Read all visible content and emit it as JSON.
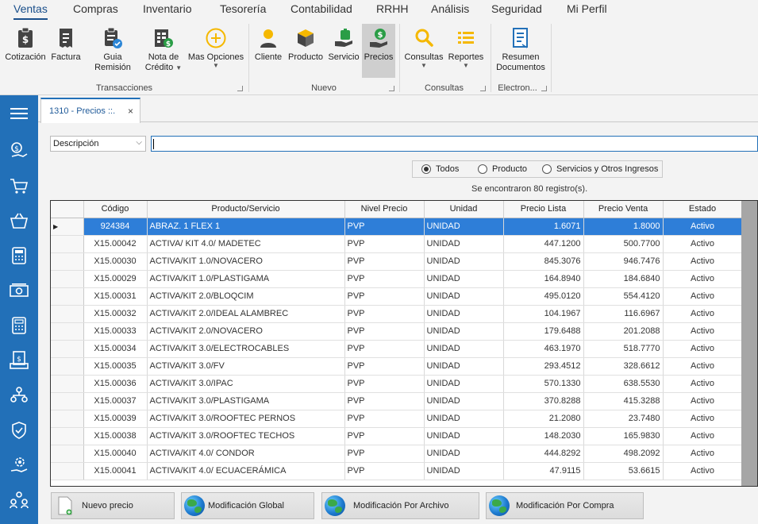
{
  "menu": [
    "Ventas",
    "Compras",
    "Inventario",
    "Tesorería",
    "Contabilidad",
    "RRHH",
    "Análisis",
    "Seguridad",
    "Mi Perfil"
  ],
  "ribbon": {
    "groups": [
      "Transacciones",
      "Nuevo",
      "Consultas",
      "Electron..."
    ],
    "buttons": {
      "cotizacion": "Cotización",
      "factura": "Factura",
      "guia": "Guia Remisión",
      "nota1": "Nota de",
      "nota2": "Crédito",
      "mas": "Mas Opciones",
      "cliente": "Cliente",
      "producto": "Producto",
      "servicio": "Servicio",
      "precios": "Precios",
      "consultas": "Consultas",
      "reportes": "Reportes",
      "resumen1": "Resumen",
      "resumen2": "Documentos"
    }
  },
  "tab": {
    "label": "1310 - Precios ::.",
    "close": "×"
  },
  "filter": {
    "field": "Descripción",
    "query": ""
  },
  "radios": {
    "todos": "Todos",
    "producto": "Producto",
    "servicios": "Servicios y Otros Ingresos"
  },
  "found_text": "Se encontraron 80 registro(s).",
  "grid": {
    "headers": [
      "Código",
      "Producto/Servicio",
      "Nivel Precio",
      "Unidad",
      "Precio Lista",
      "Precio Venta",
      "Estado"
    ],
    "rows": [
      [
        "924384",
        "ABRAZ. 1 FLEX  1",
        "PVP",
        "UNIDAD",
        "1.6071",
        "1.8000",
        "Activo"
      ],
      [
        "X15.00042",
        "ACTIVA/ KIT 4.0/ MADETEC",
        "PVP",
        "UNIDAD",
        "447.1200",
        "500.7700",
        "Activo"
      ],
      [
        "X15.00030",
        "ACTIVA/KIT 1.0/NOVACERO",
        "PVP",
        "UNIDAD",
        "845.3076",
        "946.7476",
        "Activo"
      ],
      [
        "X15.00029",
        "ACTIVA/KIT 1.0/PLASTIGAMA",
        "PVP",
        "UNIDAD",
        "164.8940",
        "184.6840",
        "Activo"
      ],
      [
        "X15.00031",
        "ACTIVA/KIT 2.0/BLOQCIM",
        "PVP",
        "UNIDAD",
        "495.0120",
        "554.4120",
        "Activo"
      ],
      [
        "X15.00032",
        "ACTIVA/KIT 2.0/IDEAL ALAMBREC",
        "PVP",
        "UNIDAD",
        "104.1967",
        "116.6967",
        "Activo"
      ],
      [
        "X15.00033",
        "ACTIVA/KIT 2.0/NOVACERO",
        "PVP",
        "UNIDAD",
        "179.6488",
        "201.2088",
        "Activo"
      ],
      [
        "X15.00034",
        "ACTIVA/KIT 3.0/ELECTROCABLES",
        "PVP",
        "UNIDAD",
        "463.1970",
        "518.7770",
        "Activo"
      ],
      [
        "X15.00035",
        "ACTIVA/KIT 3.0/FV",
        "PVP",
        "UNIDAD",
        "293.4512",
        "328.6612",
        "Activo"
      ],
      [
        "X15.00036",
        "ACTIVA/KIT 3.0/IPAC",
        "PVP",
        "UNIDAD",
        "570.1330",
        "638.5530",
        "Activo"
      ],
      [
        "X15.00037",
        "ACTIVA/KIT 3.0/PLASTIGAMA",
        "PVP",
        "UNIDAD",
        "370.8288",
        "415.3288",
        "Activo"
      ],
      [
        "X15.00039",
        "ACTIVA/KIT 3.0/ROOFTEC PERNOS",
        "PVP",
        "UNIDAD",
        "21.2080",
        "23.7480",
        "Activo"
      ],
      [
        "X15.00038",
        "ACTIVA/KIT 3.0/ROOFTEC TECHOS",
        "PVP",
        "UNIDAD",
        "148.2030",
        "165.9830",
        "Activo"
      ],
      [
        "X15.00040",
        "ACTIVA/KIT 4.0/ CONDOR",
        "PVP",
        "UNIDAD",
        "444.8292",
        "498.2092",
        "Activo"
      ],
      [
        "X15.00041",
        "ACTIVA/KIT 4.0/ ECUACERÁMICA",
        "PVP",
        "UNIDAD",
        "47.9115",
        "53.6615",
        "Activo"
      ]
    ]
  },
  "buttons": {
    "nuevo": "Nuevo precio",
    "global": "Modificación Global",
    "archivo": "Modificación Por Archivo",
    "compra": "Modificación Por Compra"
  },
  "colors": {
    "accent": "#2270b8",
    "selection": "#2e7ed8",
    "icon_yellow": "#f5b800"
  }
}
